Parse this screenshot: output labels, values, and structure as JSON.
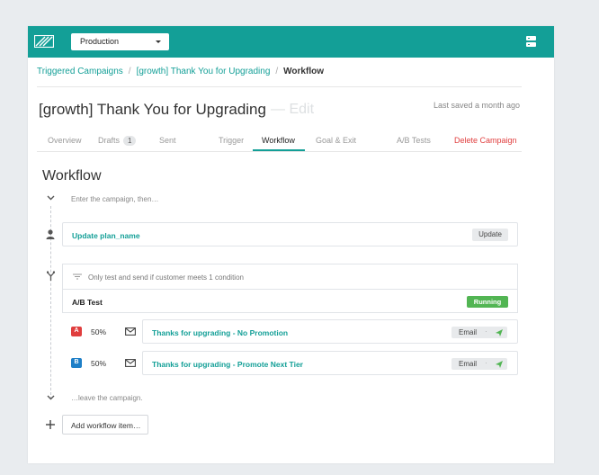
{
  "environment": {
    "selected": "Production"
  },
  "breadcrumb": {
    "items": [
      "Triggered Campaigns",
      "[growth] Thank You for Upgrading"
    ],
    "current": "Workflow"
  },
  "page": {
    "title": "[growth] Thank You for Upgrading",
    "edit_label": "— Edit",
    "last_saved": "Last saved a month ago"
  },
  "tabs": {
    "overview": "Overview",
    "drafts": "Drafts",
    "drafts_count": "1",
    "sent": "Sent",
    "trigger": "Trigger",
    "workflow": "Workflow",
    "goal_exit": "Goal & Exit",
    "ab_tests": "A/B Tests",
    "delete": "Delete Campaign"
  },
  "workflow": {
    "heading": "Workflow",
    "enter_text": "Enter the campaign, then…",
    "update_step": {
      "label": "Update plan_name",
      "button": "Update"
    },
    "ab_test": {
      "filter_text": "Only test and send if customer meets 1 condition",
      "label": "A/B Test",
      "status": "Running",
      "variants": [
        {
          "letter": "A",
          "percent": "50%",
          "name": "Thanks for upgrading - No Promotion",
          "type": "Email",
          "color": "#e03e3e"
        },
        {
          "letter": "B",
          "percent": "50%",
          "name": "Thanks for upgrading - Promote Next Tier",
          "type": "Email",
          "color": "#1e7fc7"
        }
      ]
    },
    "leave_text": "…leave the campaign.",
    "add_button": "Add workflow item…"
  },
  "colors": {
    "brand": "#139f97",
    "running": "#52b553",
    "danger": "#e03e3e"
  }
}
